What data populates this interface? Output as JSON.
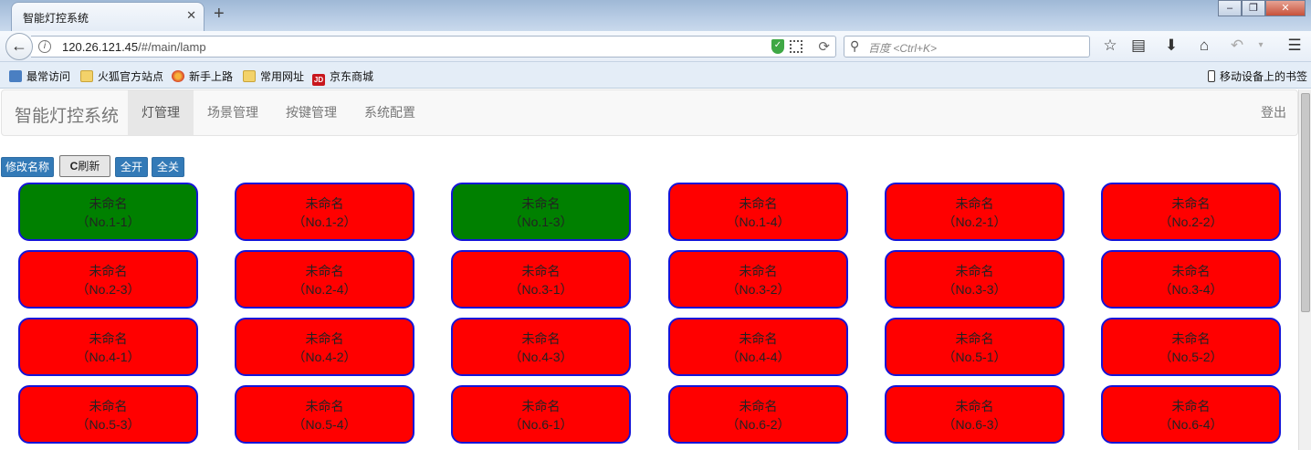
{
  "browser": {
    "tab_title": "智能灯控系统",
    "tab_close": "✕",
    "new_tab": "+",
    "window_buttons": [
      "–",
      "❐",
      "✕"
    ],
    "url_host": "120.26.121.45",
    "url_path": "/#/main/lamp",
    "search_placeholder": "百度 <Ctrl+K>",
    "bookmarks": [
      {
        "label": "最常访问",
        "icon": "most-visited-icon"
      },
      {
        "label": "火狐官方站点",
        "icon": "folder-icon"
      },
      {
        "label": "新手上路",
        "icon": "firefox-icon"
      },
      {
        "label": "常用网址",
        "icon": "folder-icon"
      },
      {
        "label": "京东商城",
        "icon": "jd-icon"
      }
    ],
    "mobile_bookmarks": "移动设备上的书签"
  },
  "app": {
    "brand": "智能灯控系统",
    "nav": [
      "灯管理",
      "场景管理",
      "按键管理",
      "系统配置"
    ],
    "active_nav": "灯管理",
    "logout": "登出"
  },
  "toolbar": {
    "rename": "修改名称",
    "refresh": "刷新",
    "all_on": "全开",
    "all_off": "全关"
  },
  "colors": {
    "lamp_on": "#008000",
    "lamp_off": "#ff0000",
    "lamp_border": "#1414d8",
    "primary": "#337ab7"
  },
  "lamps": [
    {
      "name": "未命名",
      "id": "（No.1-1）",
      "on": true
    },
    {
      "name": "未命名",
      "id": "（No.1-2）",
      "on": false
    },
    {
      "name": "未命名",
      "id": "（No.1-3）",
      "on": true
    },
    {
      "name": "未命名",
      "id": "（No.1-4）",
      "on": false
    },
    {
      "name": "未命名",
      "id": "（No.2-1）",
      "on": false
    },
    {
      "name": "未命名",
      "id": "（No.2-2）",
      "on": false
    },
    {
      "name": "未命名",
      "id": "（No.2-3）",
      "on": false
    },
    {
      "name": "未命名",
      "id": "（No.2-4）",
      "on": false
    },
    {
      "name": "未命名",
      "id": "（No.3-1）",
      "on": false
    },
    {
      "name": "未命名",
      "id": "（No.3-2）",
      "on": false
    },
    {
      "name": "未命名",
      "id": "（No.3-3）",
      "on": false
    },
    {
      "name": "未命名",
      "id": "（No.3-4）",
      "on": false
    },
    {
      "name": "未命名",
      "id": "（No.4-1）",
      "on": false
    },
    {
      "name": "未命名",
      "id": "（No.4-2）",
      "on": false
    },
    {
      "name": "未命名",
      "id": "（No.4-3）",
      "on": false
    },
    {
      "name": "未命名",
      "id": "（No.4-4）",
      "on": false
    },
    {
      "name": "未命名",
      "id": "（No.5-1）",
      "on": false
    },
    {
      "name": "未命名",
      "id": "（No.5-2）",
      "on": false
    },
    {
      "name": "未命名",
      "id": "（No.5-3）",
      "on": false
    },
    {
      "name": "未命名",
      "id": "（No.5-4）",
      "on": false
    },
    {
      "name": "未命名",
      "id": "（No.6-1）",
      "on": false
    },
    {
      "name": "未命名",
      "id": "（No.6-2）",
      "on": false
    },
    {
      "name": "未命名",
      "id": "（No.6-3）",
      "on": false
    },
    {
      "name": "未命名",
      "id": "（No.6-4）",
      "on": false
    }
  ]
}
